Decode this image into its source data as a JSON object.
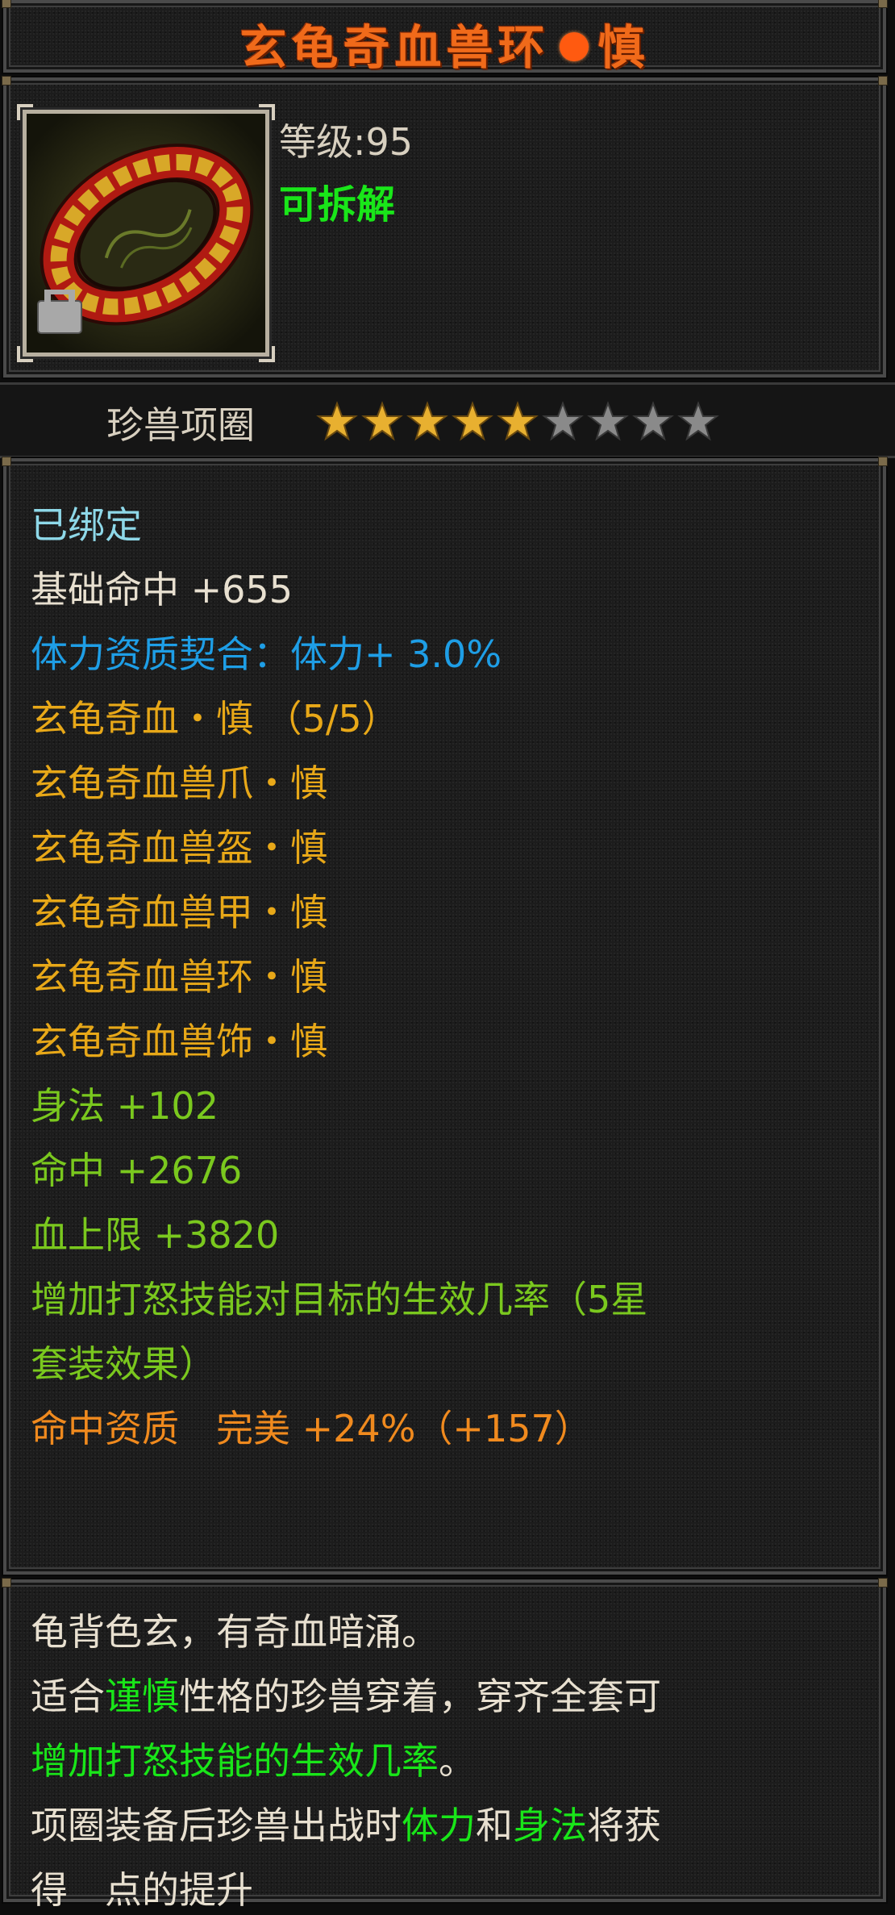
{
  "title": {
    "part1": "玄龟奇血兽环",
    "part2": "慎"
  },
  "item": {
    "icon": "beast-collar-icon",
    "level_label": "等级",
    "level_sep": ":",
    "level_value": "95",
    "dismantle": "可拆解"
  },
  "category": {
    "label": "珍兽项圈",
    "stars_filled": 5,
    "stars_total": 9
  },
  "attributes": {
    "bound": "已绑定",
    "base_hit": "基础命中 +655",
    "fit": "体力资质契合：体力+ 3.0%",
    "set_name": "玄龟奇血・慎 （5/5）",
    "set_items": [
      "玄龟奇血兽爪・慎",
      "玄龟奇血兽盔・慎",
      "玄龟奇血兽甲・慎",
      "玄龟奇血兽环・慎",
      "玄龟奇血兽饰・慎"
    ],
    "agility": "身法 +102",
    "hit": "命中 +2676",
    "hp": "血上限 +3820",
    "set_bonus_1": "增加打怒技能对目标的生效几率（5星",
    "set_bonus_2": "套装效果）",
    "aptitude": "命中资质　完美 +24%（+157）"
  },
  "description": {
    "line1": "龟背色玄，有奇血暗涌。",
    "line2_a": "适合",
    "line2_hl": "谨慎",
    "line2_b": "性格的珍兽穿着，穿齐全套可",
    "line3_hl": "增加打怒技能的生效几率",
    "line3_b": "。",
    "line4_a": "项圈装备后珍兽出战时",
    "line4_hl1": "体力",
    "line4_b": "和",
    "line4_hl2": "身法",
    "line4_c": "将获",
    "line5_a": "得",
    "line5_b": "点的提升"
  },
  "colors": {
    "title": "#f06a1a",
    "bound": "#8ed8e8",
    "white": "#e8e0d0",
    "fit": "#1e9ee6",
    "set": "#e8a818",
    "green_attr": "#7ac81e",
    "aptitude": "#f08a1e",
    "highlight": "#19e619",
    "star_on": "#e8b030",
    "star_off": "#8a8a8a"
  }
}
